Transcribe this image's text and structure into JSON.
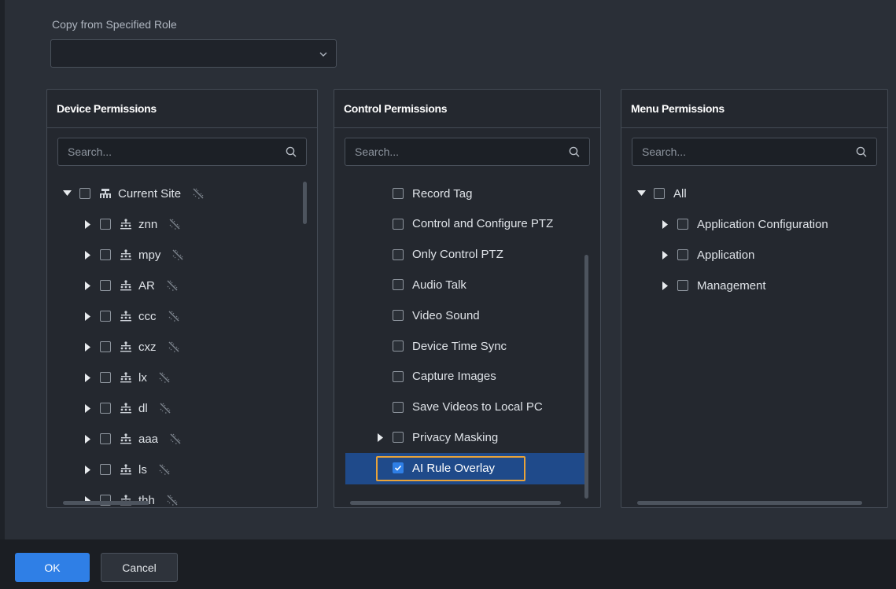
{
  "copy_role": {
    "label": "Copy from Specified Role",
    "value": ""
  },
  "device": {
    "title": "Device Permissions",
    "search_placeholder": "Search...",
    "root": "Current Site",
    "items": [
      "znn",
      "mpy",
      "AR",
      "ccc",
      "cxz",
      "lx",
      "dl",
      "aaa",
      "ls",
      "thh"
    ]
  },
  "control": {
    "title": "Control Permissions",
    "search_placeholder": "Search...",
    "items": [
      {
        "label": "Record Tag",
        "checked": false,
        "expandable": false
      },
      {
        "label": "Control and Configure PTZ",
        "checked": false,
        "expandable": false
      },
      {
        "label": "Only Control PTZ",
        "checked": false,
        "expandable": false
      },
      {
        "label": "Audio Talk",
        "checked": false,
        "expandable": false
      },
      {
        "label": "Video Sound",
        "checked": false,
        "expandable": false
      },
      {
        "label": "Device Time Sync",
        "checked": false,
        "expandable": false
      },
      {
        "label": "Capture Images",
        "checked": false,
        "expandable": false
      },
      {
        "label": "Save Videos to Local PC",
        "checked": false,
        "expandable": false
      },
      {
        "label": "Privacy Masking",
        "checked": false,
        "expandable": true
      },
      {
        "label": "AI Rule Overlay",
        "checked": true,
        "expandable": false,
        "selected": true
      }
    ]
  },
  "menu": {
    "title": "Menu Permissions",
    "search_placeholder": "Search...",
    "root": "All",
    "items": [
      "Application Configuration",
      "Application",
      "Management"
    ]
  },
  "buttons": {
    "ok": "OK",
    "cancel": "Cancel"
  },
  "colors": {
    "accent": "#2f7fe6",
    "selected_row": "#1f4a8a",
    "focus_outline": "#e8a33a"
  },
  "icons": {
    "site": "site-icon",
    "organization": "organization-icon",
    "unbound": "unbound-icon",
    "search": "search-icon",
    "expand": "caret-right-icon",
    "collapse": "caret-down-icon",
    "dropdown": "chevron-down-icon",
    "check": "check-icon"
  }
}
